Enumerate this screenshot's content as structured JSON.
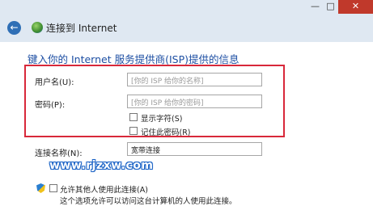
{
  "window": {
    "min_glyph": "—",
    "max_glyph": "□",
    "close_glyph": "✕"
  },
  "nav": {
    "back_glyph": "←",
    "title": "连接到 Internet"
  },
  "heading": "键入你的 Internet 服务提供商(ISP)提供的信息",
  "form": {
    "username_label": "用户名(U):",
    "username_placeholder": "[你的 ISP 给你的名称]",
    "password_label": "密码(P):",
    "password_placeholder": "[你的 ISP 给你的密码]",
    "show_chars_label": "显示字符(S)",
    "remember_label": "记住此密码(R)",
    "connection_name_label": "连接名称(N):",
    "connection_name_value": "宽带连接",
    "allow_others_label": "允许其他人使用此连接(A)",
    "allow_others_desc": "这个选项允许可以访问这台计算机的人使用此连接。"
  },
  "watermark": "www.rjzxw.com",
  "colors": {
    "highlight_box": "#d8283a",
    "heading": "#1e4fa3",
    "close_button": "#c0392b"
  }
}
